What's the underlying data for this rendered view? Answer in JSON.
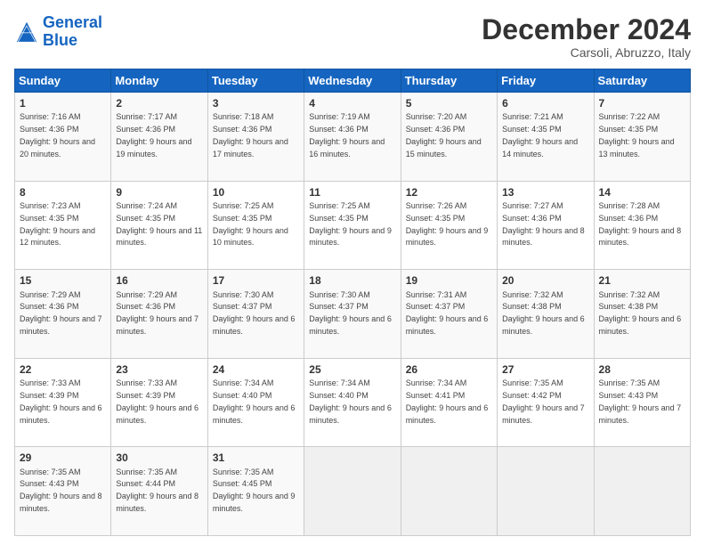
{
  "logo": {
    "line1": "General",
    "line2": "Blue"
  },
  "title": "December 2024",
  "subtitle": "Carsoli, Abruzzo, Italy",
  "days_header": [
    "Sunday",
    "Monday",
    "Tuesday",
    "Wednesday",
    "Thursday",
    "Friday",
    "Saturday"
  ],
  "weeks": [
    [
      {
        "day": "1",
        "sunrise": "7:16 AM",
        "sunset": "4:36 PM",
        "daylight": "9 hours and 20 minutes."
      },
      {
        "day": "2",
        "sunrise": "7:17 AM",
        "sunset": "4:36 PM",
        "daylight": "9 hours and 19 minutes."
      },
      {
        "day": "3",
        "sunrise": "7:18 AM",
        "sunset": "4:36 PM",
        "daylight": "9 hours and 17 minutes."
      },
      {
        "day": "4",
        "sunrise": "7:19 AM",
        "sunset": "4:36 PM",
        "daylight": "9 hours and 16 minutes."
      },
      {
        "day": "5",
        "sunrise": "7:20 AM",
        "sunset": "4:36 PM",
        "daylight": "9 hours and 15 minutes."
      },
      {
        "day": "6",
        "sunrise": "7:21 AM",
        "sunset": "4:35 PM",
        "daylight": "9 hours and 14 minutes."
      },
      {
        "day": "7",
        "sunrise": "7:22 AM",
        "sunset": "4:35 PM",
        "daylight": "9 hours and 13 minutes."
      }
    ],
    [
      {
        "day": "8",
        "sunrise": "7:23 AM",
        "sunset": "4:35 PM",
        "daylight": "9 hours and 12 minutes."
      },
      {
        "day": "9",
        "sunrise": "7:24 AM",
        "sunset": "4:35 PM",
        "daylight": "9 hours and 11 minutes."
      },
      {
        "day": "10",
        "sunrise": "7:25 AM",
        "sunset": "4:35 PM",
        "daylight": "9 hours and 10 minutes."
      },
      {
        "day": "11",
        "sunrise": "7:25 AM",
        "sunset": "4:35 PM",
        "daylight": "9 hours and 9 minutes."
      },
      {
        "day": "12",
        "sunrise": "7:26 AM",
        "sunset": "4:35 PM",
        "daylight": "9 hours and 9 minutes."
      },
      {
        "day": "13",
        "sunrise": "7:27 AM",
        "sunset": "4:36 PM",
        "daylight": "9 hours and 8 minutes."
      },
      {
        "day": "14",
        "sunrise": "7:28 AM",
        "sunset": "4:36 PM",
        "daylight": "9 hours and 8 minutes."
      }
    ],
    [
      {
        "day": "15",
        "sunrise": "7:29 AM",
        "sunset": "4:36 PM",
        "daylight": "9 hours and 7 minutes."
      },
      {
        "day": "16",
        "sunrise": "7:29 AM",
        "sunset": "4:36 PM",
        "daylight": "9 hours and 7 minutes."
      },
      {
        "day": "17",
        "sunrise": "7:30 AM",
        "sunset": "4:37 PM",
        "daylight": "9 hours and 6 minutes."
      },
      {
        "day": "18",
        "sunrise": "7:30 AM",
        "sunset": "4:37 PM",
        "daylight": "9 hours and 6 minutes."
      },
      {
        "day": "19",
        "sunrise": "7:31 AM",
        "sunset": "4:37 PM",
        "daylight": "9 hours and 6 minutes."
      },
      {
        "day": "20",
        "sunrise": "7:32 AM",
        "sunset": "4:38 PM",
        "daylight": "9 hours and 6 minutes."
      },
      {
        "day": "21",
        "sunrise": "7:32 AM",
        "sunset": "4:38 PM",
        "daylight": "9 hours and 6 minutes."
      }
    ],
    [
      {
        "day": "22",
        "sunrise": "7:33 AM",
        "sunset": "4:39 PM",
        "daylight": "9 hours and 6 minutes."
      },
      {
        "day": "23",
        "sunrise": "7:33 AM",
        "sunset": "4:39 PM",
        "daylight": "9 hours and 6 minutes."
      },
      {
        "day": "24",
        "sunrise": "7:34 AM",
        "sunset": "4:40 PM",
        "daylight": "9 hours and 6 minutes."
      },
      {
        "day": "25",
        "sunrise": "7:34 AM",
        "sunset": "4:40 PM",
        "daylight": "9 hours and 6 minutes."
      },
      {
        "day": "26",
        "sunrise": "7:34 AM",
        "sunset": "4:41 PM",
        "daylight": "9 hours and 6 minutes."
      },
      {
        "day": "27",
        "sunrise": "7:35 AM",
        "sunset": "4:42 PM",
        "daylight": "9 hours and 7 minutes."
      },
      {
        "day": "28",
        "sunrise": "7:35 AM",
        "sunset": "4:43 PM",
        "daylight": "9 hours and 7 minutes."
      }
    ],
    [
      {
        "day": "29",
        "sunrise": "7:35 AM",
        "sunset": "4:43 PM",
        "daylight": "9 hours and 8 minutes."
      },
      {
        "day": "30",
        "sunrise": "7:35 AM",
        "sunset": "4:44 PM",
        "daylight": "9 hours and 8 minutes."
      },
      {
        "day": "31",
        "sunrise": "7:35 AM",
        "sunset": "4:45 PM",
        "daylight": "9 hours and 9 minutes."
      },
      null,
      null,
      null,
      null
    ]
  ]
}
